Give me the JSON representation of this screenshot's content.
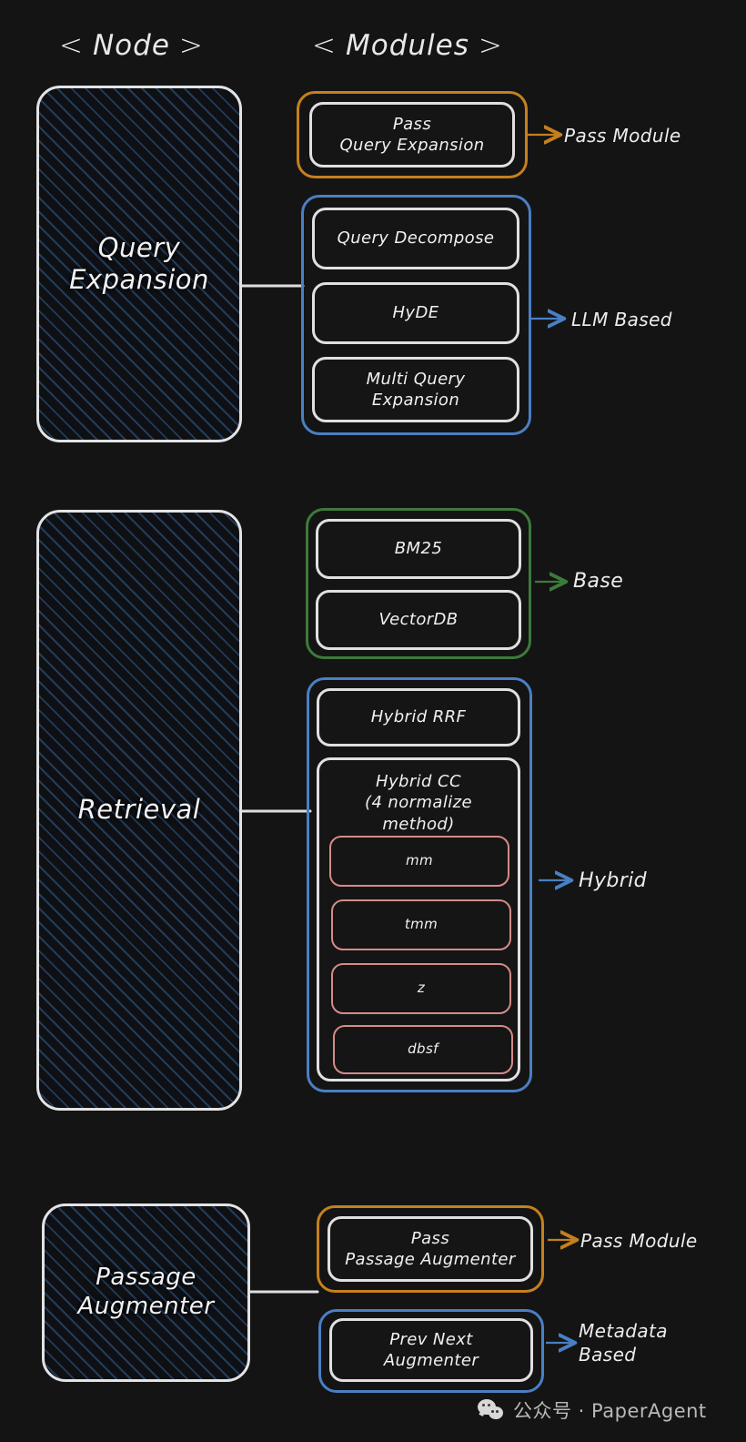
{
  "headers": {
    "node": "Node",
    "modules": "Modules",
    "open_angle": "‹",
    "close_angle": "›"
  },
  "colors": {
    "orange": "#c5801d",
    "blue": "#4a7fc4",
    "green": "#3d7a3d",
    "red": "#d58b88",
    "white": "#e0e0e0",
    "background": "#141414"
  },
  "sections": [
    {
      "node": "Query\nExpansion",
      "groups": [
        {
          "color": "orange",
          "label": "Pass Module",
          "modules": [
            {
              "text": "Pass\nQuery Expansion"
            }
          ]
        },
        {
          "color": "blue",
          "label": "LLM Based",
          "modules": [
            {
              "text": "Query Decompose"
            },
            {
              "text": "HyDE"
            },
            {
              "text": "Multi Query\nExpansion"
            }
          ]
        }
      ]
    },
    {
      "node": "Retrieval",
      "groups": [
        {
          "color": "green",
          "label": "Base",
          "modules": [
            {
              "text": "BM25"
            },
            {
              "text": "VectorDB"
            }
          ]
        },
        {
          "color": "blue",
          "label": "Hybrid",
          "modules": [
            {
              "text": "Hybrid RRF"
            },
            {
              "text": "Hybrid CC\n(4 normalize method)",
              "children": [
                {
                  "text": "mm"
                },
                {
                  "text": "tmm"
                },
                {
                  "text": "z"
                },
                {
                  "text": "dbsf"
                }
              ]
            }
          ]
        }
      ]
    },
    {
      "node": "Passage\nAugmenter",
      "groups": [
        {
          "color": "orange",
          "label": "Pass Module",
          "modules": [
            {
              "text": "Pass\nPassage Augmenter"
            }
          ]
        },
        {
          "color": "blue",
          "label": "Metadata\nBased",
          "modules": [
            {
              "text": "Prev Next\nAugmenter"
            }
          ]
        }
      ]
    }
  ],
  "watermark": {
    "text": "公众号 · PaperAgent"
  }
}
